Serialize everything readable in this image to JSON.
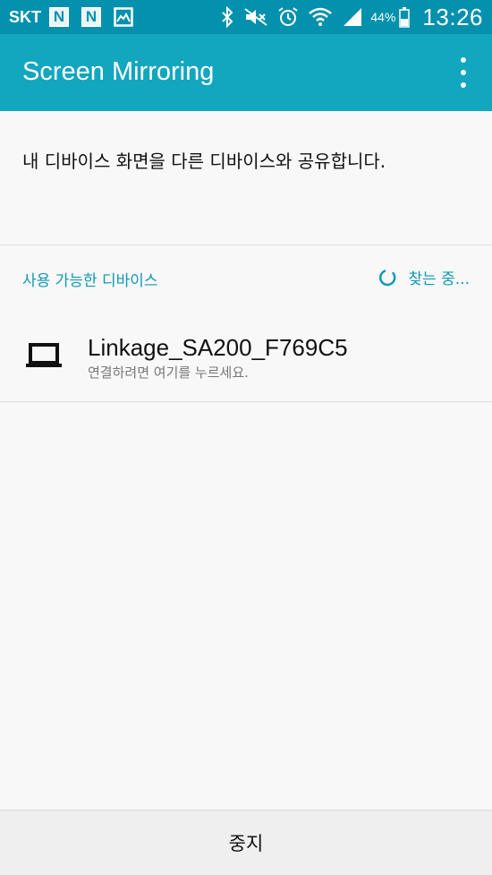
{
  "status_bar": {
    "carrier": "SKT",
    "notifications": [
      {
        "icon": "naver-n-icon",
        "label": "N"
      },
      {
        "icon": "naver-n-icon",
        "label": "N"
      },
      {
        "icon": "gallery-image-icon"
      }
    ],
    "system_icons": [
      "bluetooth-icon",
      "mute-icon",
      "alarm-icon",
      "wifi-icon",
      "signal-icon"
    ],
    "battery_percent": "44%",
    "battery_level": 0.44,
    "time": "13:26"
  },
  "app_bar": {
    "title": "Screen Mirroring",
    "menu_icon": "overflow-menu-icon"
  },
  "intro": {
    "text": "내 디바이스 화면을 다른 디바이스와 공유합니다."
  },
  "available_devices": {
    "title": "사용 가능한 디바이스",
    "status": "찾는 중..."
  },
  "devices": [
    {
      "name": "Linkage_SA200_F769C5",
      "subtitle": "연결하려면 여기를 누르세요.",
      "icon": "laptop-icon"
    }
  ],
  "bottom": {
    "stop_label": "중지"
  },
  "colors": {
    "status_bar": "#0391ad",
    "app_bar": "#12a6bf",
    "accent_text": "#1199b3"
  }
}
